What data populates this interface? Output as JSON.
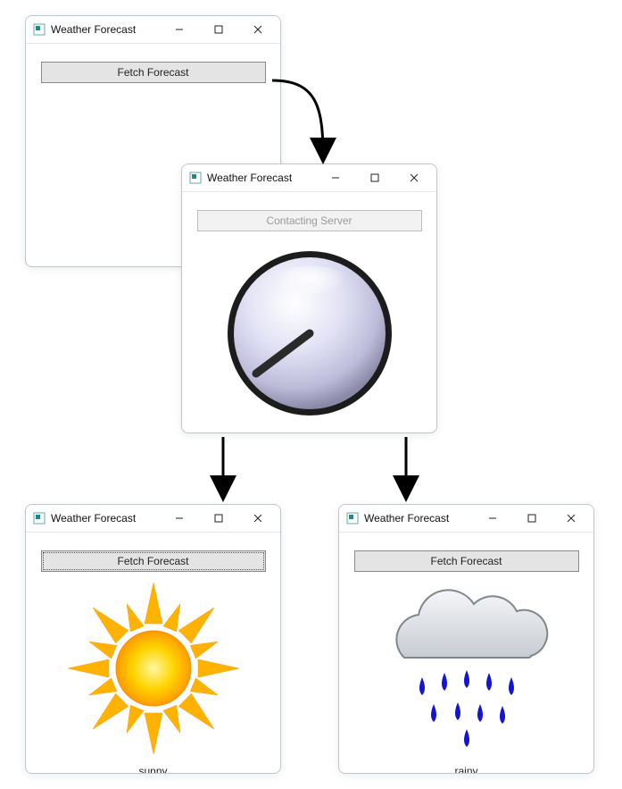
{
  "diagram": {
    "purpose": "State flow of a Weather Forecast desktop app: initial Fetch button, loading state contacting server, then branching to sunny or rainy result."
  },
  "windows": {
    "initial": {
      "title": "Weather Forecast",
      "button_label": "Fetch Forecast"
    },
    "loading": {
      "title": "Weather Forecast",
      "status_label": "Contacting Server"
    },
    "sunny": {
      "title": "Weather Forecast",
      "button_label": "Fetch Forecast",
      "caption": "sunny"
    },
    "rainy": {
      "title": "Weather Forecast",
      "button_label": "Fetch Forecast",
      "caption": "rainy"
    }
  },
  "icons": {
    "app": "app-icon",
    "minimize": "minimize-icon",
    "maximize": "maximize-icon",
    "close": "close-icon",
    "spinner": "clock-spinner-icon",
    "sun": "sun-icon",
    "rain": "rain-cloud-icon"
  }
}
